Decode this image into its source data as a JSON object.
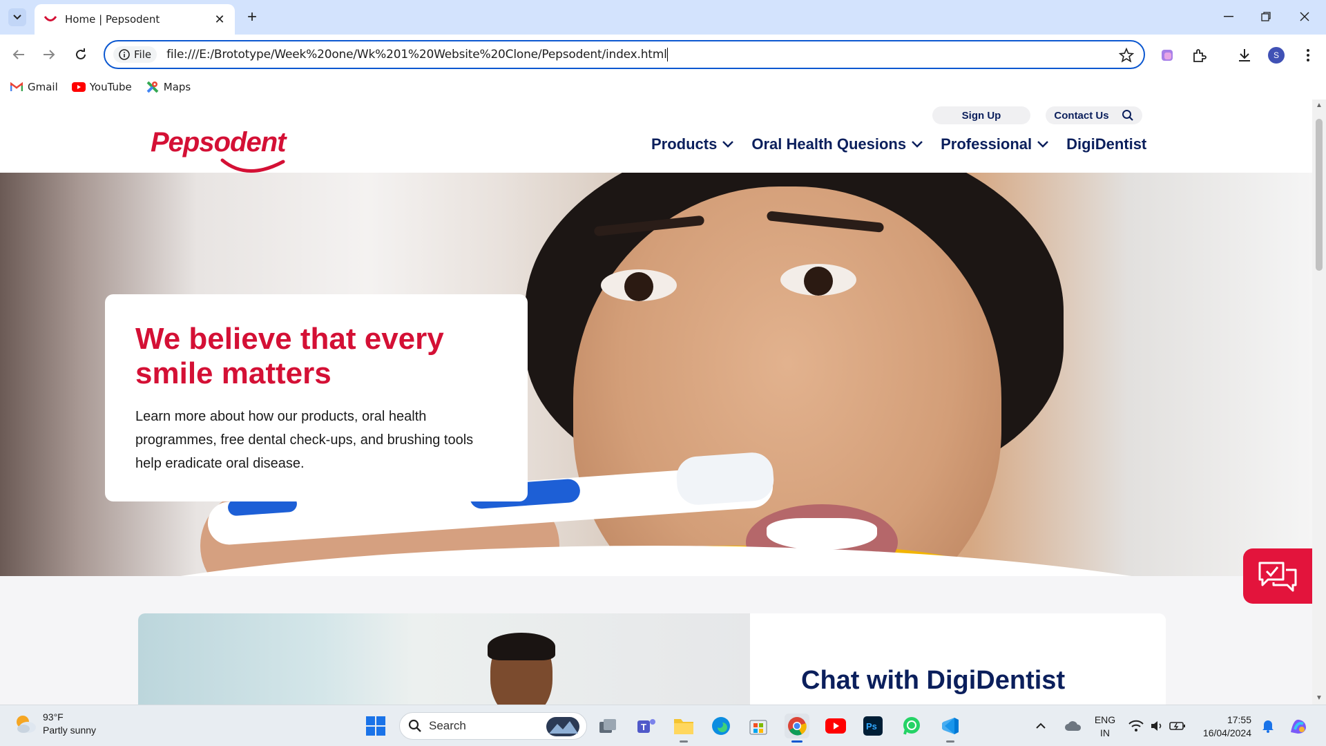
{
  "browser": {
    "tab_title": "Home | Pepsodent",
    "url": "file:///E:/Brototype/Week%20one/Wk%201%20Website%20Clone/Pepsodent/index.html",
    "site_info_label": "File",
    "profile_initial": "S",
    "bookmarks": [
      {
        "label": "Gmail",
        "icon": "gmail-icon"
      },
      {
        "label": "YouTube",
        "icon": "youtube-icon"
      },
      {
        "label": "Maps",
        "icon": "maps-icon"
      }
    ]
  },
  "page": {
    "brand": "Pepsodent",
    "utility": {
      "sign_up": "Sign Up",
      "contact_us": "Contact Us"
    },
    "nav": [
      {
        "label": "Products",
        "dropdown": true
      },
      {
        "label": "Oral Health Quesions",
        "dropdown": true
      },
      {
        "label": "Professional",
        "dropdown": true
      },
      {
        "label": "DigiDentist",
        "dropdown": false
      }
    ],
    "hero": {
      "headline": "We believe that every smile matters",
      "body": "Learn more about how our products, oral health programmes, free dental check-ups, and brushing tools help eradicate oral disease."
    },
    "digidentist": {
      "title": "Chat with DigiDentist"
    }
  },
  "taskbar": {
    "weather": {
      "temp": "93°F",
      "condition": "Partly sunny"
    },
    "search_placeholder": "Search",
    "language": {
      "line1": "ENG",
      "line2": "IN"
    },
    "time": "17:55",
    "date": "16/04/2024"
  },
  "colors": {
    "brand_red": "#d41035",
    "navy": "#0b1f5c",
    "chrome_accent": "#0b57d0"
  }
}
